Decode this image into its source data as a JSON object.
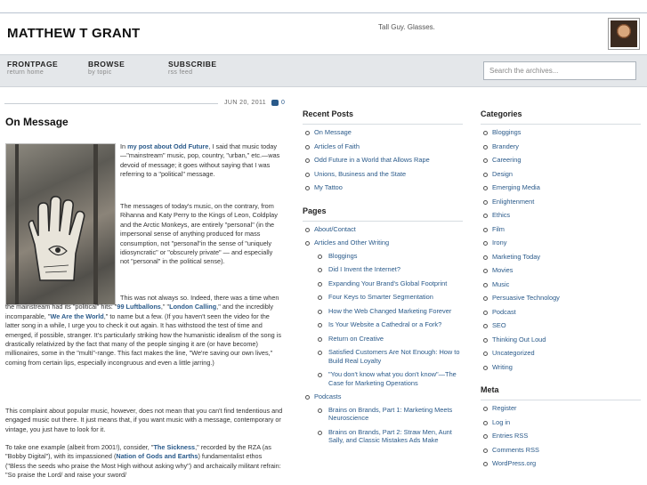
{
  "site": {
    "title": "MATTHEW T GRANT",
    "tagline": "Tall Guy. Glasses."
  },
  "nav": [
    {
      "label": "FRONTPAGE",
      "sub": "return home"
    },
    {
      "label": "BROWSE",
      "sub": "by topic"
    },
    {
      "label": "SUBSCRIBE",
      "sub": "rss feed"
    }
  ],
  "search": {
    "placeholder": "Search the archives..."
  },
  "post": {
    "date": "JUN 20, 2011",
    "comments": "0",
    "title": "On Message",
    "p1": {
      "pre": "In ",
      "link": "my post about Odd Future",
      "post": ", I said that music today—\"mainstream\" music, pop, country, \"urban,\" etc.—was devoid of message; it goes without saying that I was referring to a \"political\" message."
    },
    "p2": "The messages of today's music, on the contrary, from Rihanna and Katy Perry to the Kings of Leon, Coldplay and the Arctic Monkeys, are entirely \"personal\" (in the impersonal sense of anything produced for mass consumption, not \"personal\"in the sense of \"uniquely idiosyncratic\" or \"obscurely private\" — and especially not \"personal\" in the political sense).",
    "p3": {
      "pre": "This was not always so. Indeed, there was a time when the mainstream had its \"political\" hits: \"",
      "link1": "99 Luftballons",
      "mid1": ",\" \"",
      "link2": "London Calling",
      "mid2": ",\" and the incredibly incomparable, \"",
      "link3": "We Are the World",
      "post": ",\" to name but a few. (If you haven't seen the video for the latter song in a while, I urge you to check it out again. It has withstood the test of time and emerged, if possible, stranger. It's particularly striking how the humanistic idealism of the song is drastically relativized by the fact that many of the people singing it are (or have become) millionaires, some in the \"multi\"-range. This fact makes the line, \"We're saving our own lives,\" coming from certain lips, especially incongruous and even a little jarring.)"
    },
    "p4": "This complaint about popular music, however, does not mean that you can't find tendentious and engaged music out there. It just means that, if you want music with a message, contemporary or vintage, you just have to look for it.",
    "p5": {
      "pre": "To take one example (albeit from 2001!), consider, \"",
      "link1": "The Sickness",
      "mid1": ",\" recorded by the RZA (as \"Bobby Digital\"), with its impassioned (",
      "link2": "Nation of Gods and Earths",
      "post": ") fundamentalist ethos (\"Bless the seeds who praise the Most High without asking why\") and archaically militant refrain: \"So praise the Lord/ and raise your sword/"
    }
  },
  "recent_posts": {
    "title": "Recent Posts",
    "items": [
      "On Message",
      "Articles of Faith",
      "Odd Future in a World that Allows Rape",
      "Unions, Business and the State",
      "My Tattoo"
    ]
  },
  "pages": {
    "title": "Pages",
    "items": [
      {
        "label": "About/Contact",
        "children": []
      },
      {
        "label": "Articles and Other Writing",
        "children": [
          "Bloggings",
          "Did I Invent the Internet?",
          "Expanding Your Brand's Global Footprint",
          "Four Keys to Smarter Segmentation",
          "How the Web Changed Marketing Forever",
          "Is Your Website a Cathedral or a Fork?",
          "Return on Creative",
          "Satisfied Customers Are Not Enough: How to Build Real Loyalty",
          "\"You don't know what you don't know\"—The Case for Marketing Operations"
        ]
      },
      {
        "label": "Podcasts",
        "children": [
          "Brains on Brands, Part 1: Marketing Meets Neuroscience",
          "Brains on Brands, Part 2: Straw Men, Aunt Sally, and Classic Mistakes Ads Make"
        ]
      }
    ]
  },
  "categories": {
    "title": "Categories",
    "items": [
      "Bloggings",
      "Brandery",
      "Careering",
      "Design",
      "Emerging Media",
      "Enlightenment",
      "Ethics",
      "Film",
      "Irony",
      "Marketing Today",
      "Movies",
      "Music",
      "Persuasive Technology",
      "Podcast",
      "SEO",
      "Thinking Out Loud",
      "Uncategorized",
      "Writing"
    ]
  },
  "meta": {
    "title": "Meta",
    "items": [
      "Register",
      "Log in",
      "Entries RSS",
      "Comments RSS",
      "WordPress.org"
    ]
  },
  "colors": {
    "link": "#2a5a8a",
    "navbar": "#e4e7ea",
    "rule": "#b9c3cf"
  },
  "icons": {
    "comments": "speech-bubble-icon"
  }
}
